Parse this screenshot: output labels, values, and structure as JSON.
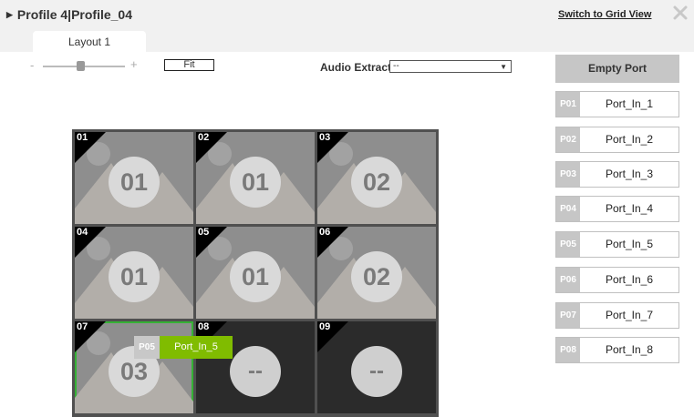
{
  "header": {
    "title": "Profile 4|Profile_04",
    "grid_link": "Switch to Grid View"
  },
  "tabs": [
    {
      "label": "Layout 1"
    }
  ],
  "toolbar": {
    "zoom_minus": "-",
    "zoom_plus": "+",
    "fit_label": "Fit",
    "audio_label": "Audio Extract",
    "audio_value": "--"
  },
  "ports": {
    "empty_label": "Empty Port",
    "items": [
      {
        "id": "P01",
        "name": "Port_In_1"
      },
      {
        "id": "P02",
        "name": "Port_In_2"
      },
      {
        "id": "P03",
        "name": "Port_In_3"
      },
      {
        "id": "P04",
        "name": "Port_In_4"
      },
      {
        "id": "P05",
        "name": "Port_In_5"
      },
      {
        "id": "P06",
        "name": "Port_In_6"
      },
      {
        "id": "P07",
        "name": "Port_In_7"
      },
      {
        "id": "P08",
        "name": "Port_In_8"
      }
    ]
  },
  "cells": [
    {
      "num": "01",
      "value": "01"
    },
    {
      "num": "02",
      "value": "01"
    },
    {
      "num": "03",
      "value": "02"
    },
    {
      "num": "04",
      "value": "01"
    },
    {
      "num": "05",
      "value": "01"
    },
    {
      "num": "06",
      "value": "02"
    },
    {
      "num": "07",
      "value": "03"
    },
    {
      "num": "08",
      "value": "--"
    },
    {
      "num": "09",
      "value": "--"
    }
  ],
  "drag_chip": {
    "id": "P05",
    "name": "Port_In_5"
  },
  "colors": {
    "selected_outline": "#35b135",
    "drag_chip": "#80bc00",
    "port_id_bg": "#c6c6c6"
  }
}
